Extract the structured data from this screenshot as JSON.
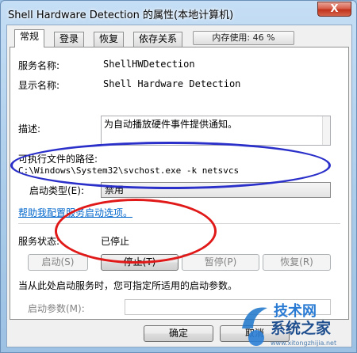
{
  "window": {
    "title": "Shell Hardware Detection 的属性(本地计算机)",
    "close_glyph": "X"
  },
  "tabs": [
    "常规",
    "登录",
    "恢复",
    "依存关系"
  ],
  "memory_usage": "内存使用: 46 %",
  "general": {
    "service_name_label": "服务名称:",
    "service_name": "ShellHWDetection",
    "display_name_label": "显示名称:",
    "display_name": "Shell Hardware Detection",
    "description_label": "描述:",
    "description": "为自动播放硬件事件提供通知。",
    "exe_path_label": "可执行文件的路径:",
    "exe_path": "C:\\Windows\\System32\\svchost.exe -k netsvcs",
    "startup_type_label": "启动类型(E):",
    "startup_type_value": "禁用",
    "help_link": "帮助我配置服务启动选项。",
    "service_status_label": "服务状态:",
    "service_status": "已停止",
    "buttons": {
      "start": "启动(S)",
      "stop": "停止(T)",
      "pause": "暂停(P)",
      "resume": "恢复(R)"
    },
    "hint": "当从此处启动服务时，您可指定所适用的启动参数。",
    "start_params_label": "启动参数(M):",
    "start_params_value": ""
  },
  "footer": {
    "ok": "确定",
    "cancel": "取消"
  },
  "watermark": {
    "line1": "技术网",
    "line2": "系统之家",
    "url": "www.xitongzhijia.net"
  },
  "colors": {
    "annotation_blue": "#2a2fc9",
    "annotation_red": "#e01818",
    "link": "#0066cc",
    "close_button": "#c7432c"
  }
}
